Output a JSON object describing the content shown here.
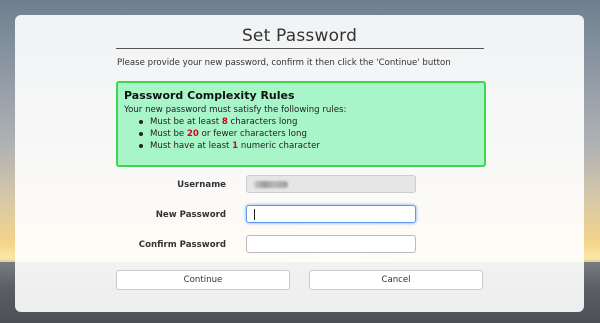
{
  "dialog": {
    "title": "Set Password",
    "instructions": "Please provide your new password, confirm it then click the 'Continue' button"
  },
  "rules": {
    "title": "Password Complexity Rules",
    "intro": "Your new password must satisfy the following rules:",
    "items": [
      {
        "prefix": "Must be at least ",
        "number": "8",
        "suffix": " characters long"
      },
      {
        "prefix": "Must be ",
        "number": "20",
        "suffix": " or fewer characters long"
      },
      {
        "prefix": "Must have at least ",
        "number": "1",
        "suffix": " numeric character"
      }
    ],
    "number_color": "#d4001c",
    "box_color": "#a8f5c9",
    "border_color": "#3fd64a"
  },
  "form": {
    "username_label": "Username",
    "new_password_label": "New Password",
    "confirm_password_label": "Confirm Password"
  },
  "buttons": {
    "continue_label": "Continue",
    "cancel_label": "Cancel"
  }
}
